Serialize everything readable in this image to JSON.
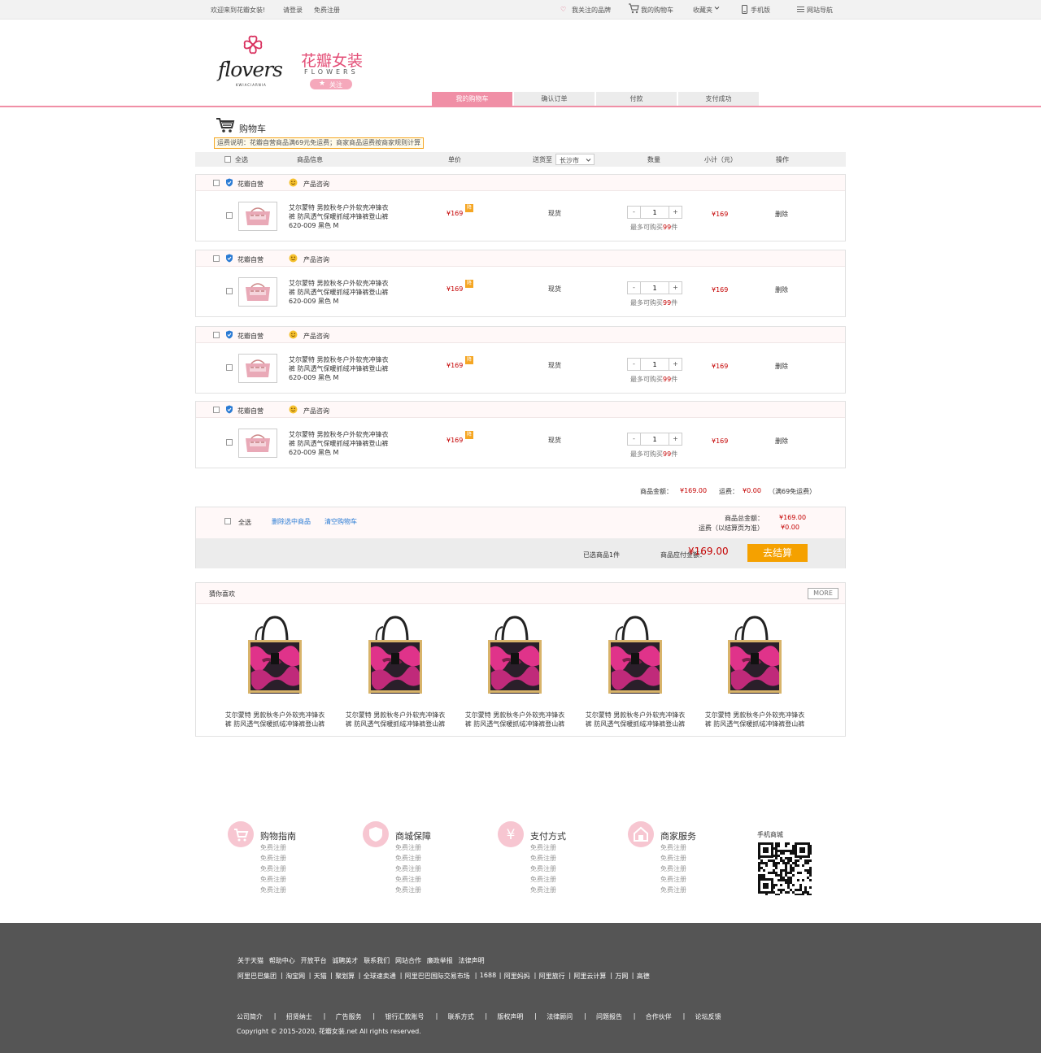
{
  "topbar": {
    "welcome": "欢迎来到花瓣女装!",
    "login": "请登录",
    "register": "免费注册",
    "brands": "我关注的品牌",
    "cart": "我的购物车",
    "favorites": "收藏夹",
    "mobile": "手机版",
    "sitenav": "网站导航"
  },
  "brand": {
    "logo_text": "flovers",
    "logo_sub": "KWIACIARNIA",
    "name_cn": "花瓣女装",
    "name_en": "FLOWERS",
    "follow": "关注"
  },
  "steps": [
    "我的购物车",
    "确认订单",
    "付款",
    "支付成功"
  ],
  "cart": {
    "title": "购物车",
    "shipping_note": "运费说明：花瓣自营商品满69元免运费；商家商品运费按商家规则计算",
    "columns": {
      "select_all": "全选",
      "info": "商品信息",
      "price": "单价",
      "ship_to": "送货至",
      "city": "长沙市",
      "qty": "数量",
      "subtotal": "小计（元）",
      "action": "操作"
    },
    "items": [
      {
        "shop": "花瓣自营",
        "consult": "产品咨询",
        "name1": "艾尔蒙特 男款秋冬户外软壳冲锋衣",
        "name2": "裤 防风透气保暖抓绒冲锋裤登山裤",
        "spec": "620-009  黑色  M",
        "price": "¥169",
        "sale": "降",
        "stock": "现货",
        "qty": "1",
        "limit_pre": "最多可购买",
        "limit_num": "99",
        "limit_post": "件",
        "subtotal": "¥169",
        "delete": "删除"
      },
      {
        "shop": "花瓣自营",
        "consult": "产品咨询",
        "name1": "艾尔蒙特 男款秋冬户外软壳冲锋衣",
        "name2": "裤 防风透气保暖抓绒冲锋裤登山裤",
        "spec": "620-009  黑色  M",
        "price": "¥169",
        "sale": "降",
        "stock": "现货",
        "qty": "1",
        "limit_pre": "最多可购买",
        "limit_num": "99",
        "limit_post": "件",
        "subtotal": "¥169",
        "delete": "删除"
      },
      {
        "shop": "花瓣自营",
        "consult": "产品咨询",
        "name1": "艾尔蒙特 男款秋冬户外软壳冲锋衣",
        "name2": "裤 防风透气保暖抓绒冲锋裤登山裤",
        "spec": "620-009  黑色  M",
        "price": "¥169",
        "sale": "降",
        "stock": "现货",
        "qty": "1",
        "limit_pre": "最多可购买",
        "limit_num": "99",
        "limit_post": "件",
        "subtotal": "¥169",
        "delete": "删除"
      },
      {
        "shop": "花瓣自营",
        "consult": "产品咨询",
        "name1": "艾尔蒙特 男款秋冬户外软壳冲锋衣",
        "name2": "裤 防风透气保暖抓绒冲锋裤登山裤",
        "spec": "620-009  黑色  M",
        "price": "¥169",
        "sale": "降",
        "stock": "现货",
        "qty": "1",
        "limit_pre": "最多可购买",
        "limit_num": "99",
        "limit_post": "件",
        "subtotal": "¥169",
        "delete": "删除"
      }
    ],
    "totals": {
      "goods_label": "商品金额：",
      "goods_value": "¥169.00",
      "freight_label": "运费：",
      "freight_value": "¥0.00",
      "freight_note": "（满69免运费）"
    },
    "summary": {
      "select_all": "全选",
      "delete_selected": "删除选中商品",
      "clear_cart": "清空购物车",
      "total_label": "商品总金额：",
      "total_value": "¥169.00",
      "freight_label": "运费（以结算页为准）",
      "freight_value": "¥0.00",
      "selected": "已选商品1件",
      "payable_label": "商品应付金额：",
      "payable_value": "¥169.00",
      "checkout": "去结算"
    }
  },
  "recommend": {
    "title": "猜你喜欢",
    "more": "MORE",
    "items": [
      {
        "name1": "艾尔蒙特 男款秋冬户外软壳冲锋衣",
        "name2": "裤 防风透气保暖抓绒冲锋裤登山裤"
      },
      {
        "name1": "艾尔蒙特 男款秋冬户外软壳冲锋衣",
        "name2": "裤 防风透气保暖抓绒冲锋裤登山裤"
      },
      {
        "name1": "艾尔蒙特 男款秋冬户外软壳冲锋衣",
        "name2": "裤 防风透气保暖抓绒冲锋裤登山裤"
      },
      {
        "name1": "艾尔蒙特 男款秋冬户外软壳冲锋衣",
        "name2": "裤 防风透气保暖抓绒冲锋裤登山裤"
      },
      {
        "name1": "艾尔蒙特 男款秋冬户外软壳冲锋衣",
        "name2": "裤 防风透气保暖抓绒冲锋裤登山裤"
      }
    ]
  },
  "help": [
    {
      "title": "购物指南",
      "icon": "cart-icon",
      "links": [
        "免费注册",
        "免费注册",
        "免费注册",
        "免费注册",
        "免费注册"
      ]
    },
    {
      "title": "商城保障",
      "icon": "shield-icon",
      "links": [
        "免费注册",
        "免费注册",
        "免费注册",
        "免费注册",
        "免费注册"
      ]
    },
    {
      "title": "支付方式",
      "icon": "yen-icon",
      "links": [
        "免费注册",
        "免费注册",
        "免费注册",
        "免费注册",
        "免费注册"
      ]
    },
    {
      "title": "商家服务",
      "icon": "store-icon",
      "links": [
        "免费注册",
        "免费注册",
        "免费注册",
        "免费注册",
        "免费注册"
      ]
    }
  ],
  "mobile_mall": "手机商城",
  "footer": {
    "row1": [
      "关于天猫",
      "帮助中心",
      "开放平台",
      "诚聘英才",
      "联系我们",
      "网站合作",
      "廉政举报",
      "法律声明"
    ],
    "row2": [
      "阿里巴巴集团",
      "淘宝网",
      "天猫",
      "聚划算",
      "全球速卖通",
      "阿里巴巴国际交易市场",
      "1688",
      "阿里妈妈",
      "阿里旅行",
      "阿里云计算",
      "万网",
      "高德"
    ],
    "row3": [
      "公司简介",
      "招贤纳士",
      "广告服务",
      "银行汇款账号",
      "联系方式",
      "版权声明",
      "法律顾问",
      "问题报告",
      "合作伙伴",
      "论坛反馈"
    ],
    "copyright": "Copyright © 2015-2020, 花瓣女装.net All rights reserved."
  },
  "colors": {
    "accent": "#f08fa6",
    "price": "#c40000",
    "checkout": "#f5a100",
    "footer": "#555555"
  }
}
